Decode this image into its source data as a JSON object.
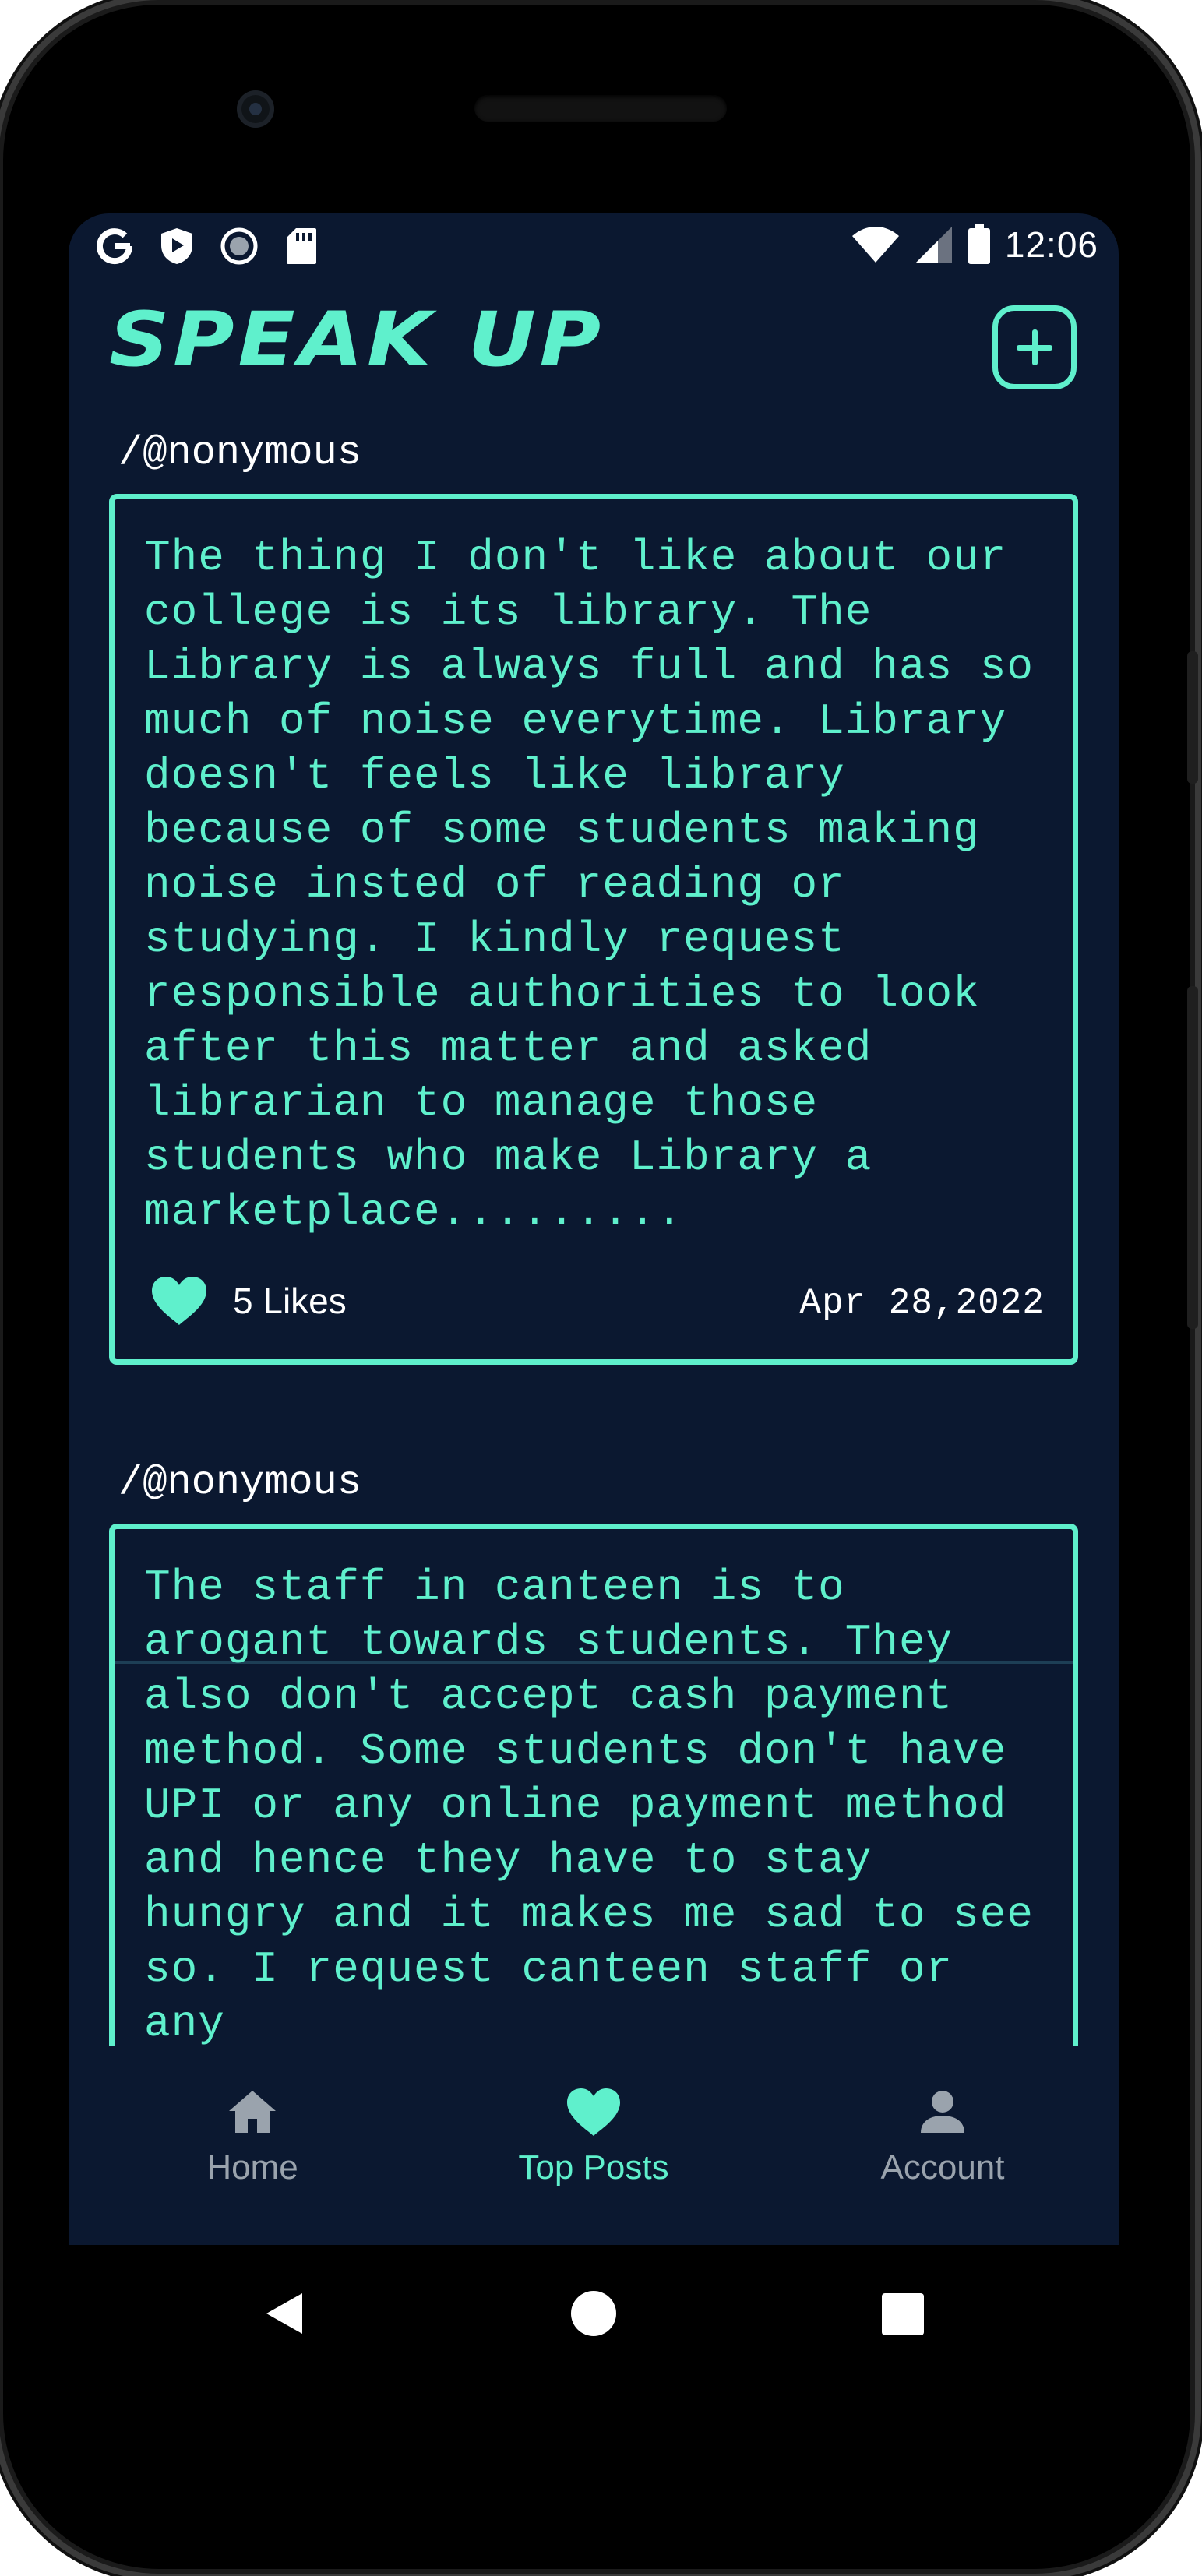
{
  "status_bar": {
    "time": "12:06",
    "left_icons": [
      "google-icon",
      "play-protect-icon",
      "record-icon",
      "sd-card-icon"
    ],
    "right_icons": [
      "wifi-icon",
      "signal-icon",
      "battery-icon"
    ]
  },
  "header": {
    "logo_text": "SPEAK UP",
    "add_button_icon": "plus-square-icon"
  },
  "posts": [
    {
      "author": "/@nonymous",
      "body": "The thing I don't like about our college is its library. The Library is always full and has so much of noise everytime. Library doesn't feels like library because of some students making noise insted of reading or studying. I kindly request responsible authorities to look after this matter and asked librarian to manage those students who make Library a marketplace.........",
      "likes": "5 Likes",
      "date": "Apr 28,2022"
    },
    {
      "author": "/@nonymous",
      "body": "The staff in canteen is to arogant towards students. They also don't accept cash payment method. Some students don't have UPI or any online payment method and hence they have to stay hungry and it makes me sad to see so. I request canteen staff or any"
    }
  ],
  "bottom_nav": {
    "items": [
      {
        "label": "Home",
        "icon": "home-icon"
      },
      {
        "label": "Top Posts",
        "icon": "heart-icon"
      },
      {
        "label": "Account",
        "icon": "person-icon"
      }
    ],
    "active": "Top Posts"
  },
  "system_nav": [
    "back-icon",
    "home-circle-icon",
    "recents-icon"
  ],
  "colors": {
    "accent": "#5ff0cc",
    "background": "#0b1830",
    "text": "#ffffff",
    "inactive": "#9aa3ad"
  }
}
